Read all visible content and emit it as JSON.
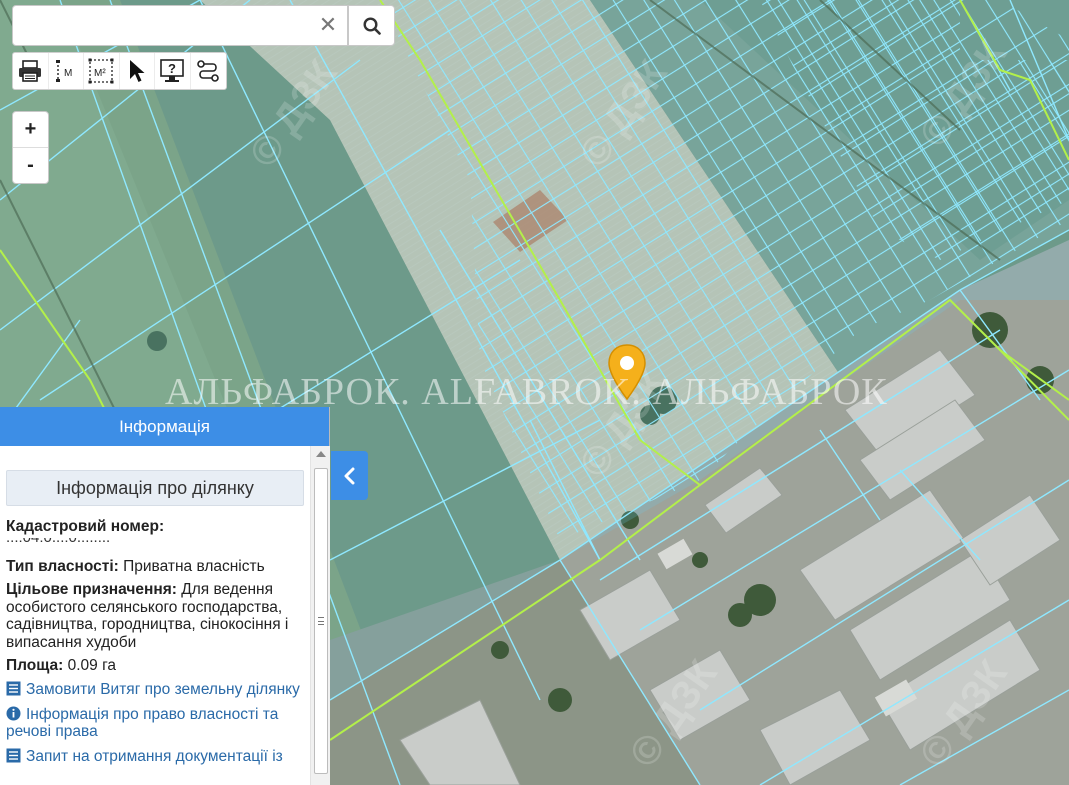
{
  "map": {
    "watermark_text": "АЛЬФАБРОК. ALFABROK. АЛЬФАБРОК",
    "marker_color": "#f5b01b",
    "highlight_color": "#8fe8ff"
  },
  "search": {
    "placeholder": "",
    "value": ""
  },
  "toolbar": {
    "tools": [
      "printer-icon",
      "measure-distance-icon",
      "measure-area-icon",
      "select-pointer-icon",
      "help-info-icon",
      "route-icon"
    ],
    "distance_unit": "M",
    "area_unit": "M²"
  },
  "zoom": {
    "in_label": "+",
    "out_label": "-"
  },
  "info_panel": {
    "header": "Інформація",
    "section_title": "Інформація про ділянку",
    "cadastral_label": "Кадастровий номер:",
    "cadastral_value": "...:04:0...:0.:...:..",
    "ownership_label": "Тип власності:",
    "ownership_value": "Приватна власність",
    "purpose_label": "Цільове призначення:",
    "purpose_value": "Для ведення особистого селянського господарства, садівництва, городництва, сінокосіння і випасання худоби",
    "area_label": "Площа:",
    "area_value": "0.09 га",
    "links": [
      {
        "icon": "list-icon",
        "label": "Замовити Витяг про земельну ділянку"
      },
      {
        "icon": "info-circle-icon",
        "label": "Інформація про право власності та речові права"
      },
      {
        "icon": "list-icon",
        "label": "Запит на отримання документації із"
      }
    ]
  },
  "collapse_button": {
    "icon": "chevron-left-icon"
  }
}
